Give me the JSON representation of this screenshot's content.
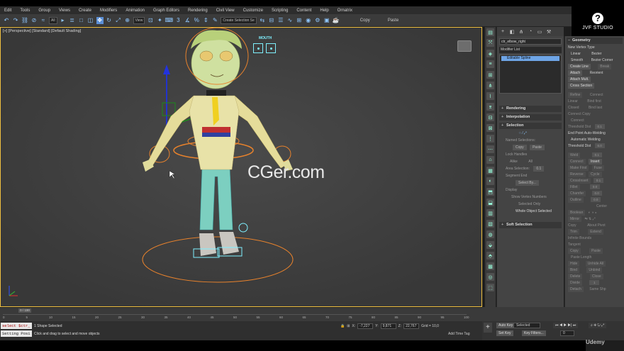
{
  "menu": [
    "Edit",
    "Tools",
    "Group",
    "Views",
    "Create",
    "Modifiers",
    "Animation",
    "Graph Editors",
    "Rendering",
    "Civil View",
    "Customize",
    "Scripting",
    "Content",
    "Help",
    "Ornatrix"
  ],
  "toolbar": {
    "filter_all": "All",
    "view_drop": "View",
    "selection_set": "Create Selection Se",
    "copy_label": "Copy",
    "paste_label": "Paste"
  },
  "studio": {
    "name": "JVF STUDIO",
    "logo_glyph": "?"
  },
  "viewport": {
    "label": "[+] [Perspective] [Standard] [Default Shading]",
    "mouth_label": "MOUTH",
    "watermark": "CGer.com"
  },
  "modify_panel": {
    "object_name": "ctr_elbow_right",
    "modifier_list": "Modifier List",
    "stack_item": "Editable Spline",
    "rollouts": {
      "rendering": "Rendering",
      "interpolation": "Interpolation",
      "selection": "Selection",
      "soft_selection": "Soft Selection"
    },
    "named_selections": "Named Selections:",
    "copy": "Copy",
    "paste": "Paste",
    "lock_handles": "Lock Handles",
    "alike": "Alike",
    "all": "All",
    "area_selection": "Area Selection:",
    "area_value": "0.1",
    "segment_end": "Segment End",
    "select_by": "Select By...",
    "display": "Display",
    "show_vertex_numbers": "Show Vertex Numbers",
    "selected_only": "Selected Only",
    "whole_object_selected": "Whole Object Selected"
  },
  "geometry_panel": {
    "title": "Geometry",
    "new_vertex_type": "New Vertex Type",
    "linear": "Linear",
    "bezier": "Bezier",
    "smooth": "Smooth",
    "bezier_corner": "Bezier Corner",
    "create_line": "Create Line",
    "break": "Break",
    "attach": "Attach",
    "reorient": "Reorient",
    "attach_mult": "Attach Mult.",
    "cross_section": "Cross Section",
    "refine": "Refine",
    "connect": "Connect",
    "linear_opt": "Linear",
    "bind_first": "Bind first",
    "closed": "Closed",
    "bind_last": "Bind last",
    "connect_copy": "Connect Copy",
    "connect_cb": "Connect",
    "threshold_dist": "Threshold Dist",
    "threshold_val": "0.1",
    "end_point_auto_welding": "End Point Auto-Welding",
    "automatic_welding": "Automatic Welding",
    "threshold_dist2": "Threshold Dist",
    "threshold_val2": "6.0",
    "weld": "Weld",
    "weld_val": "0.1",
    "connect_btn": "Connect",
    "insert": "Insert",
    "make_first": "Make First",
    "fuse": "Fuse",
    "reverse": "Reverse",
    "cycle": "Cycle",
    "crossinsert": "CrossInsert",
    "crossinsert_val": "0.1",
    "fillet": "Fillet",
    "fillet_val": "0.0",
    "chamfer": "Chamfer",
    "chamfer_val": "0.0",
    "outline": "Outline",
    "outline_val": "0.0",
    "center": "Center",
    "boolean": "Boolean",
    "mirror": "Mirror",
    "copy": "Copy",
    "about_pivot": "About Pivot",
    "trim": "Trim",
    "extend": "Extend",
    "infinite_bounds": "Infinite Bounds",
    "tangent": "Tangent",
    "t_copy": "Copy",
    "t_paste": "Paste",
    "paste_length": "Paste Length",
    "hide": "Hide",
    "unhide_all": "Unhide All",
    "bind": "Bind",
    "unbind": "Unbind",
    "delete": "Delete",
    "close": "Close",
    "divide": "Divide",
    "divide_val": "1",
    "detach": "Detach",
    "same_shp": "Same Shp"
  },
  "timeline": {
    "frame_label": "0 / 100",
    "ticks": [
      "0",
      "5",
      "10",
      "15",
      "20",
      "25",
      "30",
      "35",
      "40",
      "45",
      "50",
      "55",
      "60",
      "65",
      "70",
      "75",
      "80",
      "85",
      "90",
      "95",
      "100"
    ]
  },
  "status": {
    "maxscript_line1": "select $ctr_",
    "maxscript_line2": "Setting Posi",
    "selected": "1 Shape Selected",
    "hint": "Click and drag to select and move objects",
    "x_label": "X:",
    "x_value": "-7,227",
    "y_label": "Y:",
    "y_value": "9,871",
    "z_label": "Z:",
    "z_value": "22,767",
    "grid": "Grid = 10,0",
    "add_time_tag": "Add Time Tag"
  },
  "anim": {
    "auto_key": "Auto Key",
    "selected": "Selected",
    "set_key": "Set Key",
    "key_filters": "Key Filters...",
    "frame": "0"
  },
  "branding": {
    "udemy": "Udemy"
  },
  "colors": {
    "viewport_bg": "#3f3f3f",
    "selection_cyan": "#7ff0ff",
    "accent_blue": "#6ea5e6",
    "orange_circle": "#e8822c"
  }
}
